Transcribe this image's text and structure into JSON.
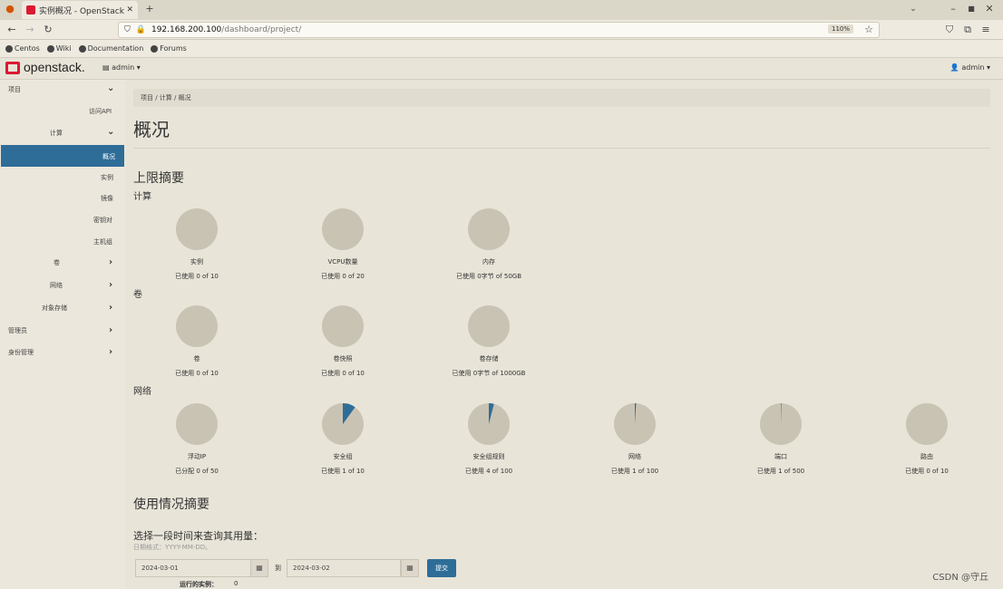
{
  "browser": {
    "tab_title": "实例概况 - OpenStack Da",
    "url_host": "192.168.200.100",
    "url_path": "/dashboard/project/",
    "zoom": "110%",
    "bookmarks": [
      "Centos",
      "Wiki",
      "Documentation",
      "Forums"
    ]
  },
  "header": {
    "logo": "openstack.",
    "project": "admin",
    "user": "admin"
  },
  "sidebar": {
    "project": "项目",
    "access_api": "访问API",
    "compute": "计算",
    "overview": "概况",
    "instances": "实例",
    "images": "镜像",
    "keypairs": "密钥对",
    "server_groups": "主机组",
    "volumes": "卷",
    "network": "网络",
    "object_store": "对象存储",
    "admin": "管理员",
    "identity": "身份管理"
  },
  "breadcrumb": "项目 / 计算 / 概况",
  "page_title": "概况",
  "limits": {
    "title": "上限摘要",
    "compute": {
      "title": "计算",
      "gauges": [
        {
          "label": "实例",
          "usage": "已使用 0 of 10",
          "fraction": 0
        },
        {
          "label": "VCPU数量",
          "usage": "已使用 0 of 20",
          "fraction": 0
        },
        {
          "label": "内存",
          "usage": "已使用 0字节 of 50GB",
          "fraction": 0
        }
      ]
    },
    "volume": {
      "title": "卷",
      "gauges": [
        {
          "label": "卷",
          "usage": "已使用 0 of 10",
          "fraction": 0
        },
        {
          "label": "卷快照",
          "usage": "已使用 0 of 10",
          "fraction": 0
        },
        {
          "label": "卷存储",
          "usage": "已使用 0字节 of 1000GB",
          "fraction": 0
        }
      ]
    },
    "network": {
      "title": "网络",
      "gauges": [
        {
          "label": "浮动IP",
          "usage": "已分配 0 of 50",
          "fraction": 0
        },
        {
          "label": "安全组",
          "usage": "已使用 1 of 10",
          "fraction": 0.1
        },
        {
          "label": "安全组规则",
          "usage": "已使用 4 of 100",
          "fraction": 0.04
        },
        {
          "label": "网络",
          "usage": "已使用 1 of 100",
          "fraction": 0.01
        },
        {
          "label": "端口",
          "usage": "已使用 1 of 500",
          "fraction": 0.002
        },
        {
          "label": "路由",
          "usage": "已使用 0 of 10",
          "fraction": 0
        }
      ]
    }
  },
  "usage": {
    "title": "使用情况摘要",
    "range_label": "选择一段时间来查询其用量：",
    "date_hint": "日期格式：YYYY-MM-DD。",
    "start": "2024-03-01",
    "to": "到",
    "end": "2024-03-02",
    "submit": "提交",
    "running_label": "运行的实例：",
    "running_value": "0"
  },
  "watermark": "CSDN @守丘",
  "colors": {
    "accent": "#2e6d98",
    "gauge_bg": "#c9c3b3",
    "brand": "#da1a32"
  }
}
